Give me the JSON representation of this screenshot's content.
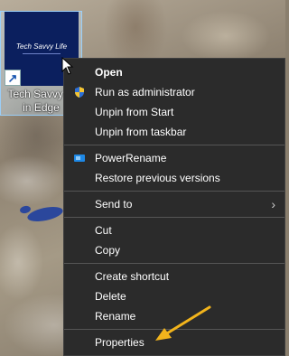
{
  "desktop": {
    "shortcut": {
      "thumbnail_text": "Tech Savvy Life",
      "caption": "Tech Savvy Li\nin Edge"
    }
  },
  "context_menu": {
    "items": [
      {
        "label": "Open",
        "bold": true,
        "icon": null
      },
      {
        "label": "Run as administrator",
        "icon": "uac-shield-icon"
      },
      {
        "label": "Unpin from Start",
        "icon": null
      },
      {
        "label": "Unpin from taskbar",
        "icon": null
      },
      {
        "separator": true
      },
      {
        "label": "PowerRename",
        "icon": "powerrename-icon"
      },
      {
        "label": "Restore previous versions",
        "icon": null
      },
      {
        "separator": true
      },
      {
        "label": "Send to",
        "icon": null,
        "submenu": true
      },
      {
        "separator": true
      },
      {
        "label": "Cut",
        "icon": null
      },
      {
        "label": "Copy",
        "icon": null
      },
      {
        "separator": true
      },
      {
        "label": "Create shortcut",
        "icon": null
      },
      {
        "label": "Delete",
        "icon": null
      },
      {
        "label": "Rename",
        "icon": null
      },
      {
        "separator": true
      },
      {
        "label": "Properties",
        "icon": null
      }
    ]
  },
  "colors": {
    "menu_bg": "#2b2b2b",
    "annotation_arrow": "#f2b41c"
  }
}
